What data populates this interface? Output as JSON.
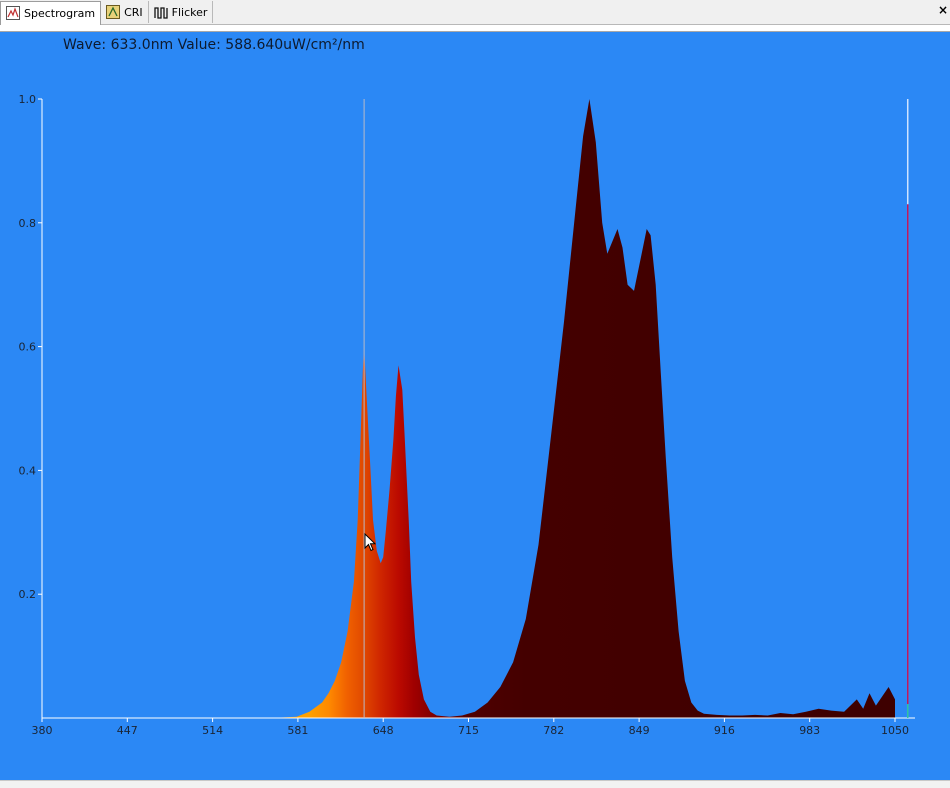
{
  "tabs": [
    {
      "label": "Spectrogram",
      "icon": "spectrogram-icon",
      "active": true
    },
    {
      "label": "CRI",
      "icon": "cri-icon",
      "active": false
    },
    {
      "label": "Flicker",
      "icon": "flicker-icon",
      "active": false
    }
  ],
  "close_label": "×",
  "readout": {
    "wave_label": "Wave:",
    "wave_value": "633.0nm",
    "value_label": "Value:",
    "value_value": "588.640uW/cm²/nm"
  },
  "chart_data": {
    "type": "area",
    "title": "",
    "xlabel": "",
    "ylabel": "",
    "xlim": [
      380,
      1050
    ],
    "ylim": [
      0,
      1.0
    ],
    "grid": false,
    "background": "#2b88f5",
    "x_ticks": [
      "380",
      "447",
      "514",
      "581",
      "648",
      "715",
      "782",
      "849",
      "916",
      "983",
      "1050"
    ],
    "y_ticks": [
      "0.2",
      "0.4",
      "0.6",
      "0.8",
      "1.0"
    ],
    "cursor_nm": 633.0,
    "right_marker_nm": 1060,
    "right_marker_level": 0.83,
    "series": [
      {
        "x": [
          380,
          560,
          580,
          590,
          600,
          605,
          610,
          615,
          620,
          625,
          628,
          630,
          632,
          633,
          635,
          638,
          640,
          643,
          646,
          648,
          650,
          653,
          656,
          658,
          660,
          663,
          665,
          668,
          670,
          673,
          676,
          680,
          685,
          690,
          700,
          710,
          720,
          730,
          740,
          750,
          760,
          770,
          780,
          790,
          800,
          805,
          810,
          815,
          820,
          824,
          828,
          832,
          836,
          840,
          845,
          850,
          855,
          858,
          862,
          866,
          870,
          875,
          880,
          885,
          890,
          895,
          900,
          910,
          920,
          930,
          940,
          950,
          960,
          970,
          980,
          990,
          1000,
          1010,
          1015,
          1020,
          1025,
          1030,
          1035,
          1040,
          1045,
          1050
        ],
        "y": [
          0,
          0,
          0.002,
          0.01,
          0.025,
          0.04,
          0.06,
          0.09,
          0.14,
          0.22,
          0.32,
          0.44,
          0.56,
          0.6,
          0.52,
          0.4,
          0.32,
          0.27,
          0.25,
          0.26,
          0.3,
          0.37,
          0.45,
          0.52,
          0.57,
          0.53,
          0.45,
          0.32,
          0.22,
          0.13,
          0.07,
          0.03,
          0.01,
          0.004,
          0.002,
          0.004,
          0.01,
          0.025,
          0.05,
          0.09,
          0.16,
          0.28,
          0.46,
          0.64,
          0.84,
          0.94,
          1.0,
          0.93,
          0.8,
          0.75,
          0.77,
          0.79,
          0.76,
          0.7,
          0.69,
          0.74,
          0.79,
          0.78,
          0.7,
          0.56,
          0.42,
          0.26,
          0.14,
          0.06,
          0.025,
          0.012,
          0.007,
          0.005,
          0.004,
          0.004,
          0.005,
          0.004,
          0.008,
          0.006,
          0.01,
          0.015,
          0.012,
          0.01,
          0.02,
          0.03,
          0.015,
          0.04,
          0.02,
          0.035,
          0.05,
          0.03
        ]
      }
    ]
  }
}
